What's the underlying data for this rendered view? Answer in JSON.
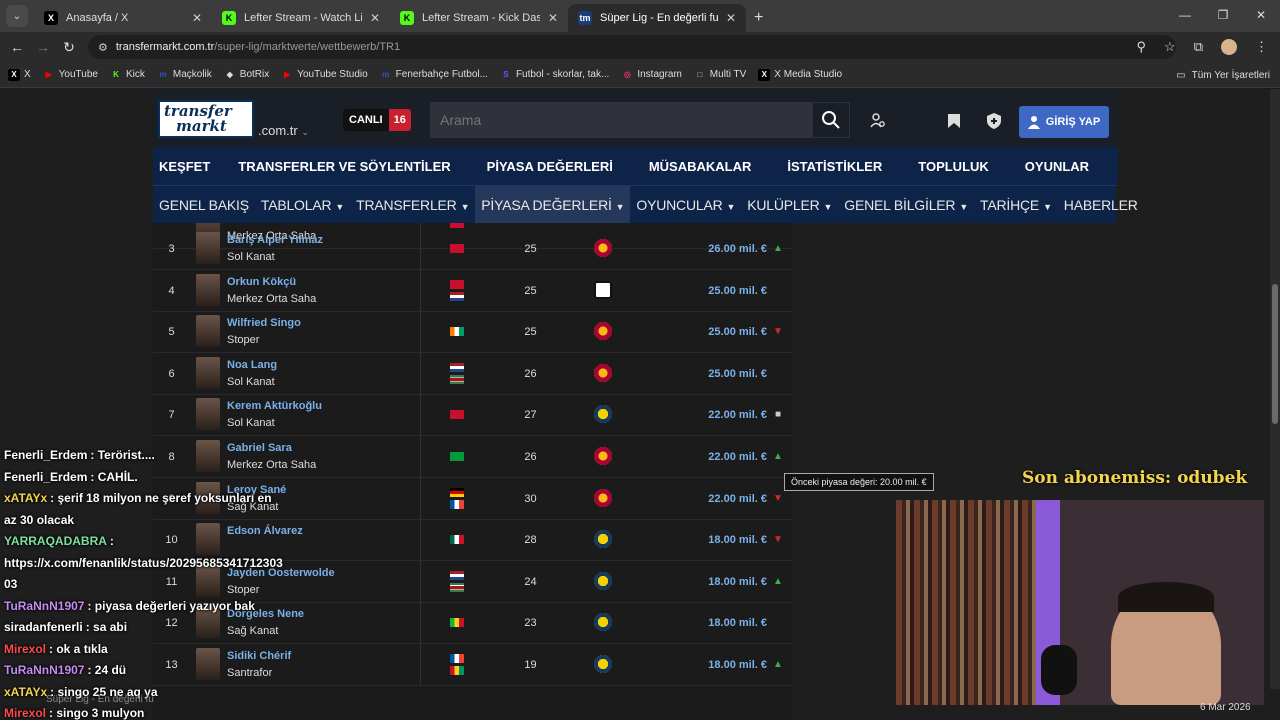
{
  "browser": {
    "tabs": [
      {
        "title": "Anasayfa / X",
        "icon": "x-logo-icon",
        "active": false,
        "favicon_color": "#000000",
        "glyph": "X"
      },
      {
        "title": "Lefter Stream - Watch Live on K",
        "icon": "kick-icon",
        "active": false,
        "favicon_color": "#53fc18",
        "glyph": "K"
      },
      {
        "title": "Lefter Stream - Kick Dashboard",
        "icon": "kick-icon",
        "active": false,
        "favicon_color": "#53fc18",
        "glyph": "K"
      },
      {
        "title": "Süper Lig - En değerli futbolcul",
        "icon": "transfermarkt-icon",
        "active": true,
        "favicon_color": "#1a3c78",
        "glyph": "tm"
      }
    ],
    "url_host": "transfermarkt.com.tr",
    "url_path": "/super-lig/marktwerte/wettbewerb/TR1",
    "bookmarks": [
      {
        "label": "X",
        "glyph": "X",
        "color": "#000000"
      },
      {
        "label": "YouTube",
        "glyph": "▶",
        "color": "#ff0000"
      },
      {
        "label": "Kick",
        "glyph": "K",
        "color": "#53fc18"
      },
      {
        "label": "Maçkolik",
        "glyph": "m",
        "color": "#2857c5"
      },
      {
        "label": "BotRix",
        "glyph": "◆",
        "color": "#dddddd"
      },
      {
        "label": "YouTube Studio",
        "glyph": "▶",
        "color": "#ff0000"
      },
      {
        "label": "Fenerbahçe Futbol...",
        "glyph": "m",
        "color": "#2857c5"
      },
      {
        "label": "Futbol - skorlar, tak...",
        "glyph": "S",
        "color": "#5a5aff"
      },
      {
        "label": "Instagram",
        "glyph": "◎",
        "color": "#e1306c"
      },
      {
        "label": "Multi TV",
        "glyph": "□",
        "color": "#cccccc"
      },
      {
        "label": "X Media Studio",
        "glyph": "X",
        "color": "#000000"
      }
    ],
    "all_bookmarks_label": "Tüm Yer İşaretleri"
  },
  "site": {
    "logo_line1": "transfer",
    "logo_line2": "markt",
    "domain": ".com.tr",
    "live_label": "CANLI",
    "live_count": "16",
    "search_placeholder": "Arama",
    "login_label": "GİRİŞ YAP",
    "main_nav": [
      "KEŞFET",
      "TRANSFERLER VE SÖYLENTİLER",
      "PİYASA DEĞERLERİ",
      "MÜSABAKALAR",
      "İSTATİSTİKLER",
      "TOPLULUK",
      "OYUNLAR"
    ],
    "sub_nav": [
      {
        "label": "GENEL BAKIŞ",
        "caret": ""
      },
      {
        "label": "TABLOLAR",
        "caret": "▼"
      },
      {
        "label": "TRANSFERLER",
        "caret": "▼"
      },
      {
        "label": "PİYASA DEĞERLERİ",
        "caret": "▼"
      },
      {
        "label": "OYUNCULAR",
        "caret": "▼"
      },
      {
        "label": "KULÜPLER",
        "caret": "▼"
      },
      {
        "label": "GENEL BİLGİLER",
        "caret": "▼"
      },
      {
        "label": "TARİHÇE",
        "caret": "▼"
      },
      {
        "label": "HABERLER",
        "caret": ""
      }
    ],
    "sub_nav_active": "PİYASA DEĞERLERİ"
  },
  "players_partial_top": {
    "pos": "Merkez Orta Saha"
  },
  "players": [
    {
      "rank": "3",
      "name": "Barış Alper Yılmaz",
      "pos": "Sol Kanat",
      "flags": [
        "tr"
      ],
      "age": "25",
      "club": "gs",
      "value": "26.00 mil. €",
      "trend": "up"
    },
    {
      "rank": "4",
      "name": "Orkun Kökçü",
      "pos": "Merkez Orta Saha",
      "flags": [
        "tr",
        "nl"
      ],
      "age": "25",
      "club": "bjk",
      "value": "25.00 mil. €",
      "trend": ""
    },
    {
      "rank": "5",
      "name": "Wilfried Singo",
      "pos": "Stoper",
      "flags": [
        "ci"
      ],
      "age": "25",
      "club": "gs",
      "value": "25.00 mil. €",
      "trend": "down"
    },
    {
      "rank": "6",
      "name": "Noa Lang",
      "pos": "Sol Kanat",
      "flags": [
        "nl",
        "sr"
      ],
      "age": "26",
      "club": "gs",
      "value": "25.00 mil. €",
      "trend": ""
    },
    {
      "rank": "7",
      "name": "Kerem Aktürkoğlu",
      "pos": "Sol Kanat",
      "flags": [
        "tr"
      ],
      "age": "27",
      "club": "fb",
      "value": "22.00 mil. €",
      "trend": "same"
    },
    {
      "rank": "8",
      "name": "Gabriel Sara",
      "pos": "Merkez Orta Saha",
      "flags": [
        "br"
      ],
      "age": "26",
      "club": "gs",
      "value": "22.00 mil. €",
      "trend": "up"
    },
    {
      "rank": "9",
      "name": "Leroy Sané",
      "pos": "Sağ Kanat",
      "flags": [
        "de",
        "fr"
      ],
      "age": "30",
      "club": "gs",
      "value": "22.00 mil. €",
      "trend": "down"
    },
    {
      "rank": "10",
      "name": "Edson Álvarez",
      "pos": "",
      "flags": [
        "mx"
      ],
      "age": "28",
      "club": "fb",
      "value": "18.00 mil. €",
      "trend": "down"
    },
    {
      "rank": "11",
      "name": "Jayden Oosterwolde",
      "pos": "Stoper",
      "flags": [
        "nl",
        "sr"
      ],
      "age": "24",
      "club": "fb",
      "value": "18.00 mil. €",
      "trend": "up"
    },
    {
      "rank": "12",
      "name": "Dorgeles Nene",
      "pos": "Sağ Kanat",
      "flags": [
        "ml"
      ],
      "age": "23",
      "club": "fb",
      "value": "18.00 mil. €",
      "trend": ""
    },
    {
      "rank": "13",
      "name": "Sidiki Chérif",
      "pos": "Santrafor",
      "flags": [
        "fr",
        "gn"
      ],
      "age": "19",
      "club": "fb",
      "value": "18.00 mil. €",
      "trend": "up"
    }
  ],
  "tooltip": "Önceki piyasa değeri: 20.00 mil. €",
  "chat": [
    {
      "user": "Fenerli_Erdem",
      "msg": ": Terörist....",
      "color": "#ffffff"
    },
    {
      "user": "Fenerli_Erdem",
      "msg": ": CAHİL.",
      "color": "#ffffff"
    },
    {
      "user": "xATAYx",
      "msg": ": şerif 18 milyon ne şeref yoksunları en",
      "color": "#f5d54e"
    },
    {
      "user": "",
      "msg": "az 30 olacak",
      "color": "#ffffff"
    },
    {
      "user": "YARRAQADABRA",
      "msg": ":",
      "color": "#7ee0a0"
    },
    {
      "user": "",
      "msg": "https://x.com/fenanlik/status/20295685341712303",
      "color": "#ffffff"
    },
    {
      "user": "",
      "msg": "03",
      "color": "#ffffff"
    },
    {
      "user": "TuRaNnN1907",
      "msg": ": piyasa değerleri yazıyor bak",
      "color": "#c68cf5"
    },
    {
      "user": "siradanfenerli",
      "msg": ": sa abi",
      "color": "#ffffff"
    },
    {
      "user": "Mirexol",
      "msg": ": ok a tıkla",
      "color": "#ff4b4b"
    },
    {
      "user": "TuRaNnN1907",
      "msg": ": 24 dü",
      "color": "#c68cf5"
    },
    {
      "user": "xATAYx",
      "msg": ": singo 25 ne aq ya",
      "color": "#f5d54e"
    },
    {
      "user": "Mirexol",
      "msg": ": singo 3 mulyon",
      "color": "#ff4b4b"
    }
  ],
  "sub_alert": "Son abonemiss: odubek",
  "date": "6 Mar 2026",
  "bottom_tab_label": "Süper Lig - En değerli fu"
}
